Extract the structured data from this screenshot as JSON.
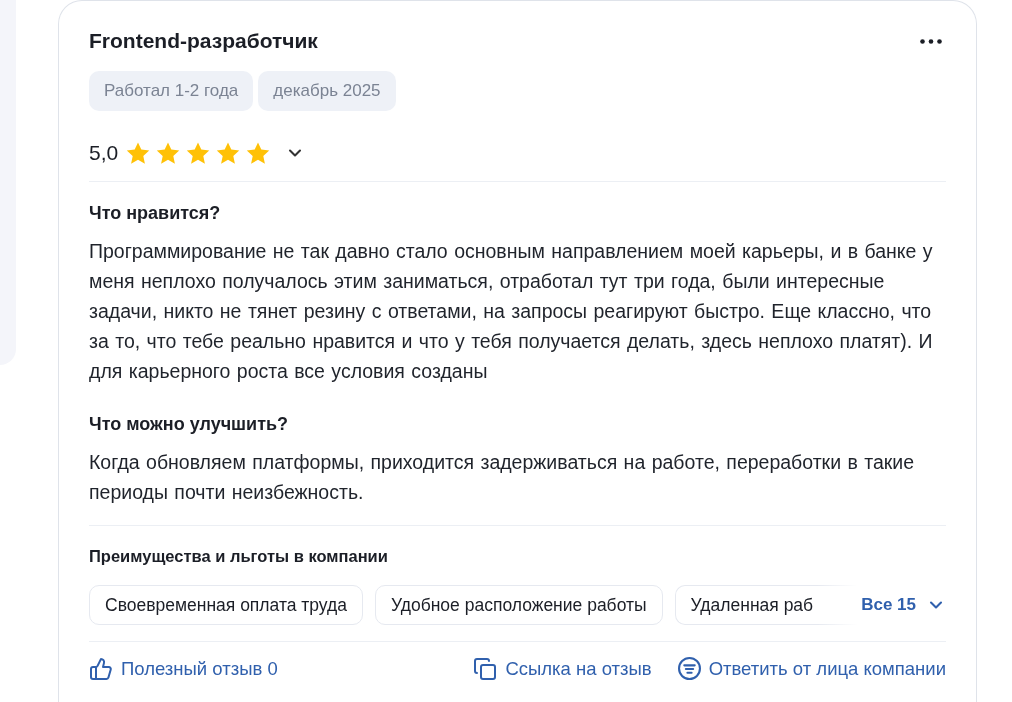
{
  "review": {
    "title": "Frontend-разработчик",
    "tags": [
      "Работал 1-2 года",
      "декабрь 2025"
    ],
    "rating": {
      "value": "5,0",
      "stars": 5
    },
    "sections": [
      {
        "heading": "Что нравится?",
        "text": "Программирование не так давно стало основным направлением моей карьеры, и в банке у меня неплохо получалось этим заниматься, отработал тут три года, были интересные задачи, никто не тянет резину с ответами, на запросы реагируют быстро. Еще классно, что за то, что тебе реально нравится и что у тебя получается делать, здесь неплохо платят). И для карьерного роста все условия созданы"
      },
      {
        "heading": "Что можно улучшить?",
        "text": "Когда обновляем платформы, приходится задерживаться на работе, переработки в такие периоды почти неизбежность."
      }
    ],
    "benefits": {
      "heading": "Преимущества и льготы в компании",
      "items": [
        {
          "label": "Своевременная оплата труда",
          "faded": false
        },
        {
          "label": "Удобное расположение работы",
          "faded": false
        },
        {
          "label": "Удаленная раб",
          "faded": true
        }
      ],
      "more": "Все 15"
    },
    "actions": [
      {
        "kind": "helpful",
        "label": "Полезный отзыв 0"
      },
      {
        "kind": "link",
        "label": "Ссылка на отзыв"
      },
      {
        "kind": "reply",
        "label": "Ответить от лица компании"
      }
    ]
  }
}
